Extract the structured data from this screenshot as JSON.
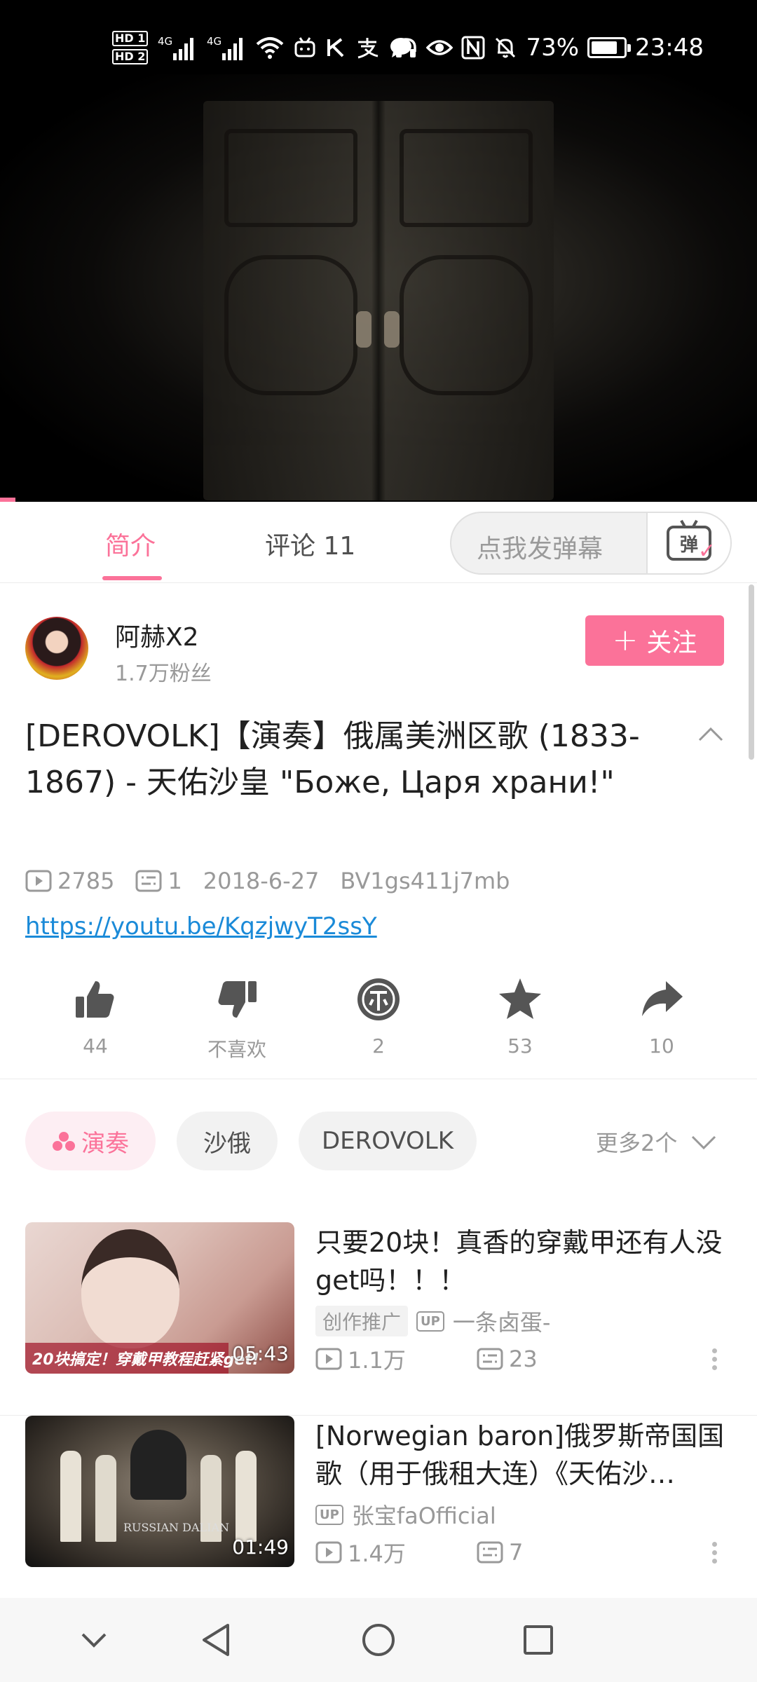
{
  "status_bar": {
    "hd1": "HD 1",
    "hd2": "HD 2",
    "signal1": "4G",
    "signal2": "4G",
    "battery_percent": "73%",
    "time": "23:48",
    "icons": [
      "wifi-icon",
      "bilibili-icon",
      "k-icon",
      "alipay-icon",
      "chat-icon",
      "headset-icon",
      "eye-icon",
      "nfc-icon",
      "mute-icon"
    ]
  },
  "video": {
    "progress_fraction": 0.02
  },
  "tabs": {
    "intro": "简介",
    "comments": "评论 11",
    "danmaku_placeholder": "点我发弹幕",
    "danmaku_icon_char": "弹"
  },
  "uploader": {
    "name": "阿赫X2",
    "fans": "1.7万粉丝",
    "follow_label": "关注"
  },
  "video_info": {
    "title": "[DEROVOLK]【演奏】俄属美洲区歌 (1833-1867) - 天佑沙皇 \"Боже, Царя храни!\"",
    "views": "2785",
    "danmaku_count": "1",
    "date": "2018-6-27",
    "bvid": "BV1gs411j7mb",
    "link": "https://youtu.be/KqzjwyT2ssY"
  },
  "actions": [
    {
      "icon": "thumbs-up-icon",
      "label": "44"
    },
    {
      "icon": "thumbs-down-icon",
      "label": "不喜欢"
    },
    {
      "icon": "coin-icon",
      "label": "2"
    },
    {
      "icon": "star-icon",
      "label": "53"
    },
    {
      "icon": "share-icon",
      "label": "10"
    }
  ],
  "tags": {
    "items": [
      "演奏",
      "沙俄",
      "DEROVOLK"
    ],
    "more": "更多2个"
  },
  "recommended": [
    {
      "title": "只要20块！真香的穿戴甲还有人没get吗！！！",
      "badge": "创作推广",
      "uploader": "一条卤蛋-",
      "views": "1.1万",
      "danmaku": "23",
      "duration": "05:43",
      "thumb_text": "20块搞定！穿戴甲教程赶紧get!"
    },
    {
      "title": "[Norwegian baron]俄罗斯帝国国歌（用于俄租大连）《天佑沙…",
      "uploader": "张宝faOfficial",
      "views": "1.4万",
      "danmaku": "7",
      "duration": "01:49",
      "thumb_text": "RUSSIAN DALIAN"
    }
  ],
  "colors": {
    "accent": "#fb7299",
    "link": "#1a8ad8",
    "secondary_text": "#999999"
  }
}
